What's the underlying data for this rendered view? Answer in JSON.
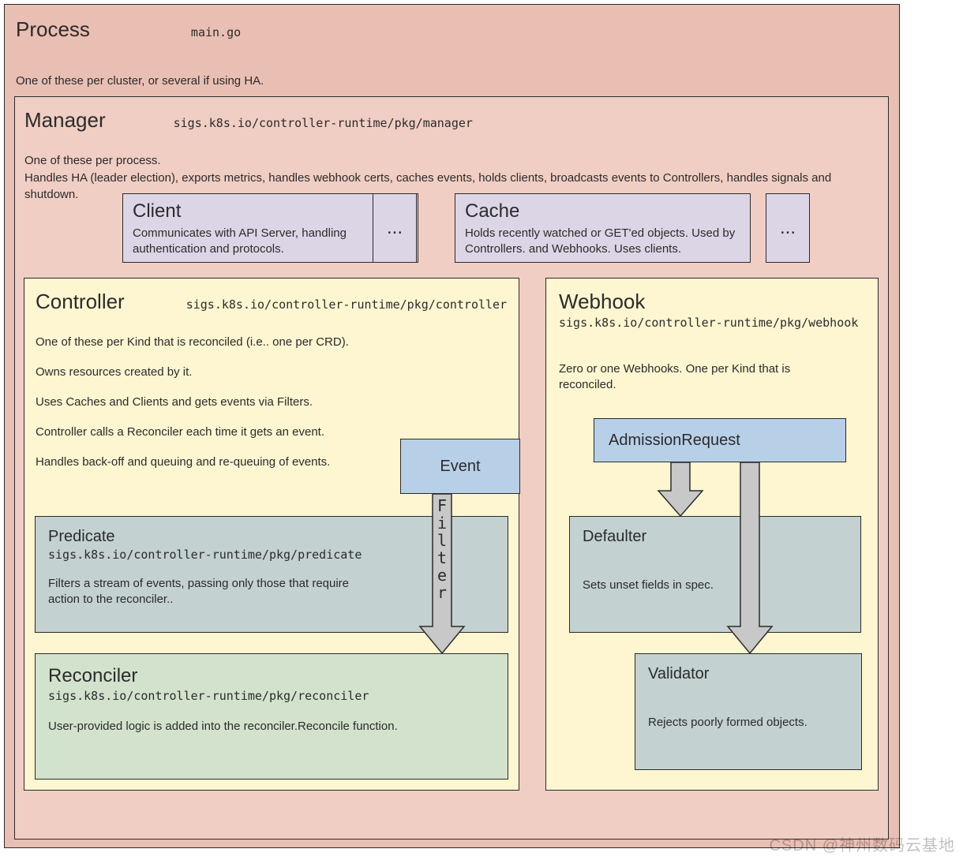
{
  "process": {
    "title": "Process",
    "subtitle": "main.go",
    "desc": "One of these per cluster, or several if using HA."
  },
  "manager": {
    "title": "Manager",
    "subtitle": "sigs.k8s.io/controller-runtime/pkg/manager",
    "desc1": "One of these per process.",
    "desc2": "Handles HA (leader election), exports metrics, handles webhook certs, caches events, holds clients, broadcasts events to Controllers, handles signals and shutdown."
  },
  "client": {
    "title": "Client",
    "desc": "Communicates with API Server, handling authentication and protocols."
  },
  "dots1": "...",
  "cache": {
    "title": "Cache",
    "desc": "Holds recently watched or GET'ed objects.   Used by Controllers. and Webhooks.  Uses clients."
  },
  "dots2": "...",
  "controller": {
    "title": "Controller",
    "subtitle": "sigs.k8s.io/controller-runtime/pkg/controller",
    "p1": "One of these per Kind that is reconciled (i.e.. one per CRD).",
    "p2": "Owns resources created by it.",
    "p3": "Uses Caches and Clients and gets events via Filters.",
    "p4": "Controller calls a Reconciler each time it gets an event.",
    "p5": "Handles back-off and queuing and re-queuing of events."
  },
  "event": {
    "title": "Event"
  },
  "filter_label": "Filter",
  "predicate": {
    "title": "Predicate",
    "subtitle": "sigs.k8s.io/controller-runtime/pkg/predicate",
    "desc": "Filters a stream of events, passing only those that require\n action to the reconciler.."
  },
  "reconciler": {
    "title": "Reconciler",
    "subtitle": "sigs.k8s.io/controller-runtime/pkg/reconciler",
    "desc": "User-provided logic is added into the reconciler.Reconcile function."
  },
  "webhook": {
    "title": "Webhook",
    "subtitle": "sigs.k8s.io/controller-runtime/pkg/webhook",
    "desc": "Zero or one Webhooks.  One per Kind that is reconciled."
  },
  "admission": {
    "title": "AdmissionRequest"
  },
  "defaulter": {
    "title": "Defaulter",
    "desc": "Sets unset fields in spec."
  },
  "validator": {
    "title": "Validator",
    "desc": "Rejects poorly formed objects."
  },
  "watermark": "CSDN @神州数码云基地"
}
